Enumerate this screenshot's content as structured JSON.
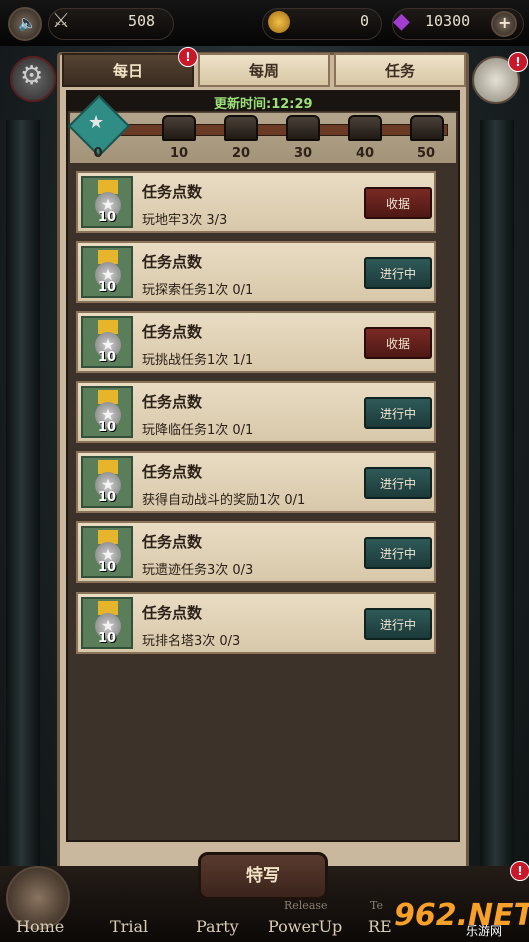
{
  "hud": {
    "sword_value": "508",
    "coin_value": "0",
    "gem_value": "10300",
    "plus": "+"
  },
  "tabs": [
    {
      "label": "每日",
      "active": true
    },
    {
      "label": "每周",
      "active": false
    },
    {
      "label": "任务",
      "active": false
    }
  ],
  "alert": "!",
  "timer": {
    "label": "更新时间:",
    "value": "12:29"
  },
  "milestones": [
    "0",
    "10",
    "20",
    "30",
    "40",
    "50"
  ],
  "quests": [
    {
      "title": "任务点数",
      "desc": "玩地牢3次 3/3",
      "points": "10",
      "button": "收据",
      "state": "claim"
    },
    {
      "title": "任务点数",
      "desc": "玩探索任务1次 0/1",
      "points": "10",
      "button": "进行中",
      "state": "progress"
    },
    {
      "title": "任务点数",
      "desc": "玩挑战任务1次 1/1",
      "points": "10",
      "button": "收据",
      "state": "claim"
    },
    {
      "title": "任务点数",
      "desc": "玩降临任务1次 0/1",
      "points": "10",
      "button": "进行中",
      "state": "progress"
    },
    {
      "title": "任务点数",
      "desc": "获得自动战斗的奖励1次 0/1",
      "points": "10",
      "button": "进行中",
      "state": "progress"
    },
    {
      "title": "任务点数",
      "desc": "玩遗迹任务3次 0/3",
      "points": "10",
      "button": "进行中",
      "state": "progress"
    },
    {
      "title": "任务点数",
      "desc": "玩排名塔3次 0/3",
      "points": "10",
      "button": "进行中",
      "state": "progress"
    }
  ],
  "special_button": "特写",
  "nav": [
    "Home",
    "Trial",
    "Party",
    "PowerUp",
    "RE"
  ],
  "nav_small": [
    "Release",
    "Te"
  ],
  "watermark": {
    "main": "962.NET",
    "sub": "乐游网"
  },
  "colors": {
    "claim": "#5e1f1b",
    "progress": "#244544",
    "timer": "#9be07b",
    "alert": "#c8182a"
  }
}
